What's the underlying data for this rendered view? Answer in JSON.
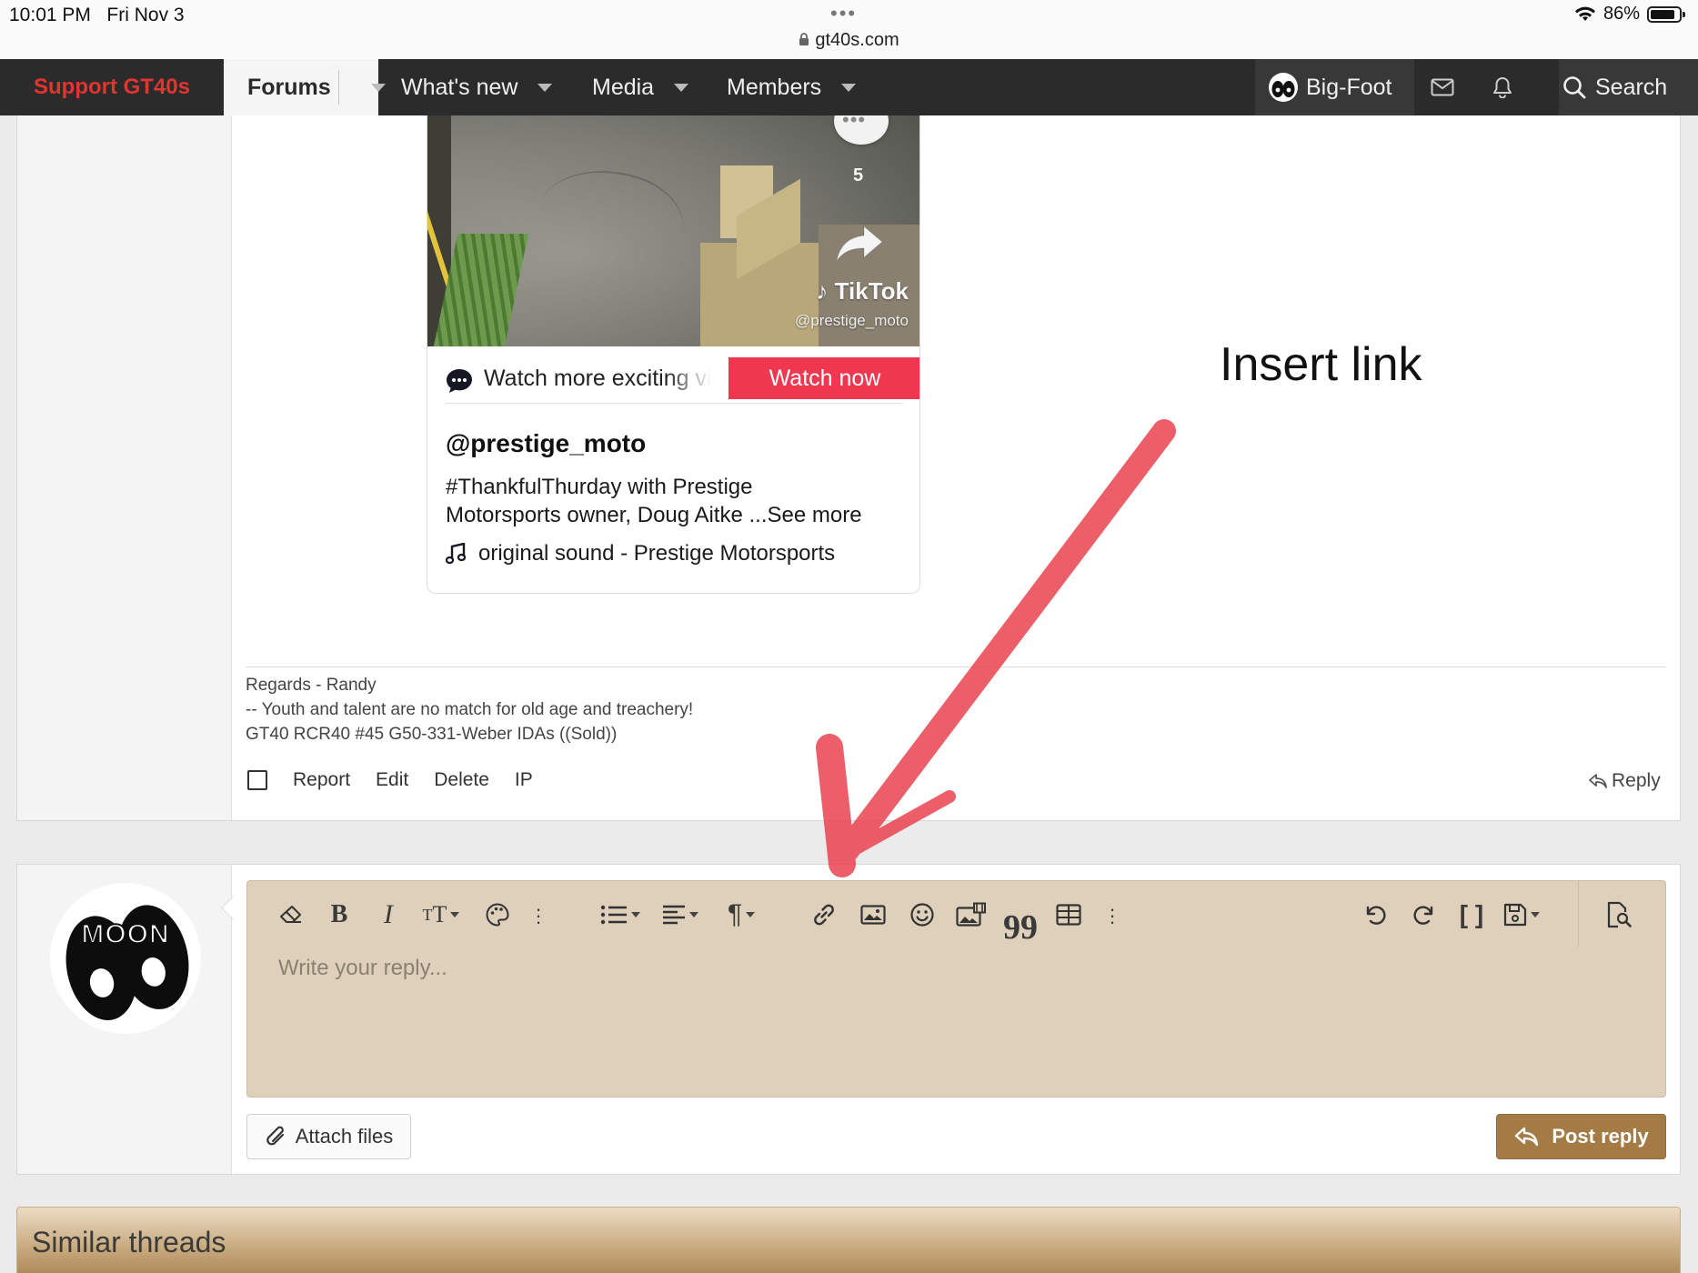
{
  "status_bar": {
    "time": "10:01 PM",
    "date": "Fri Nov 3",
    "menu_dots": "•••",
    "url": "gt40s.com",
    "battery_percent": "86%",
    "battery_level": 0.86
  },
  "nav": {
    "support": "Support GT40s",
    "forums": "Forums",
    "whats_new": "What's new",
    "media": "Media",
    "members": "Members",
    "username": "Big-Foot",
    "search": "Search"
  },
  "embed": {
    "comment_count": "5",
    "brand": "TikTok",
    "overlay_handle": "@prestige_moto",
    "watch_more": "Watch more exciting videos on TikTok",
    "watch_now": "Watch now",
    "username": "@prestige_moto",
    "description_line1": "#ThankfulThurday with Prestige",
    "description_line2": "Motorsports owner, Doug Aitke ...See more",
    "sound": "original sound - Prestige Motorsports"
  },
  "annotation": {
    "label": "Insert link",
    "color": "#e9434f"
  },
  "post": {
    "signature": [
      "Regards - Randy",
      "-- Youth and talent are no match for old age and treachery!",
      "GT40 RCR40 #45 G50-331-Weber IDAs ((Sold))"
    ],
    "actions": {
      "report": "Report",
      "edit": "Edit",
      "delete": "Delete",
      "ip": "IP",
      "reply": "Reply"
    }
  },
  "reply_editor": {
    "placeholder": "Write your reply...",
    "toolbar_icons": [
      "eraser-icon",
      "bold-icon",
      "italic-icon",
      "font-size-icon",
      "palette-icon",
      "more-icon",
      "list-icon",
      "align-icon",
      "paragraph-icon",
      "link-icon",
      "image-icon",
      "smiley-icon",
      "media-icon",
      "quote-icon",
      "table-icon",
      "more-icon",
      "undo-icon",
      "redo-icon",
      "bbcode-icon",
      "drafts-icon",
      "preview-icon"
    ],
    "attach_files": "Attach files",
    "post_reply": "Post reply",
    "avatar_text": "MOON"
  },
  "similar_threads": {
    "title": "Similar threads"
  },
  "colors": {
    "nav_bg": "#2b2b2b",
    "support_red": "#e3342f",
    "tiktok_red": "#ef3850",
    "editor_bg": "#ded0ba",
    "post_button": "#a47b45"
  }
}
